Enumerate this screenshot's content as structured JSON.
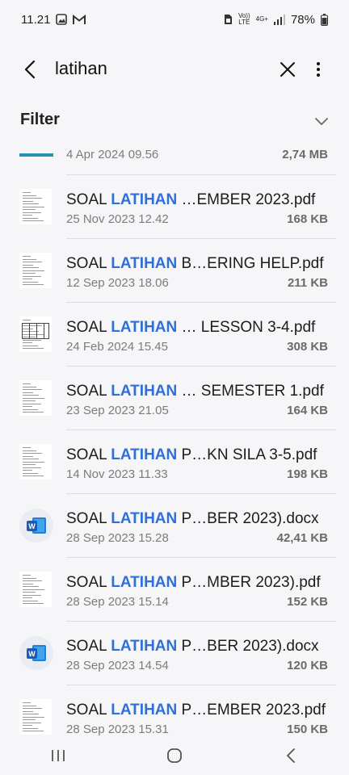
{
  "status": {
    "time": "11.21",
    "volte": "Vo))",
    "lte": "LTE",
    "net": "4G+",
    "battery": "78%"
  },
  "search": {
    "query": "latihan"
  },
  "filter": {
    "label": "Filter"
  },
  "highlight_color": "#2f6fd8",
  "partial_item": {
    "date": "4 Apr 2024 09.56",
    "size": "2,74 MB"
  },
  "files": [
    {
      "prefix": "SOAL ",
      "hl": "LATIHAN",
      "suffix": " …EMBER 2023.pdf",
      "date": "25 Nov 2023 12.42",
      "size": "168 KB",
      "icon": "pdf-thumbnail"
    },
    {
      "prefix": "SOAL ",
      "hl": "LATIHAN",
      "suffix": " B…ERING HELP.pdf",
      "date": "12 Sep 2023 18.06",
      "size": "211 KB",
      "icon": "pdf-thumbnail"
    },
    {
      "prefix": "SOAL ",
      "hl": "LATIHAN",
      "suffix": " … LESSON 3-4.pdf",
      "date": "24 Feb 2024 15.45",
      "size": "308 KB",
      "icon": "pdf-thumbnail-table"
    },
    {
      "prefix": "SOAL ",
      "hl": "LATIHAN",
      "suffix": " … SEMESTER 1.pdf",
      "date": "23 Sep 2023 21.05",
      "size": "164 KB",
      "icon": "pdf-thumbnail"
    },
    {
      "prefix": "SOAL ",
      "hl": "LATIHAN",
      "suffix": " P…KN SILA 3-5.pdf",
      "date": "14 Nov 2023 11.33",
      "size": "198 KB",
      "icon": "pdf-thumbnail"
    },
    {
      "prefix": "SOAL ",
      "hl": "LATIHAN",
      "suffix": " P…BER 2023).docx",
      "date": "28 Sep 2023 15.28",
      "size": "42,41 KB",
      "icon": "word-icon"
    },
    {
      "prefix": "SOAL ",
      "hl": "LATIHAN",
      "suffix": " P…MBER 2023).pdf",
      "date": "28 Sep 2023 15.14",
      "size": "152 KB",
      "icon": "pdf-thumbnail"
    },
    {
      "prefix": "SOAL ",
      "hl": "LATIHAN",
      "suffix": " P…BER 2023).docx",
      "date": "28 Sep 2023 14.54",
      "size": "120 KB",
      "icon": "word-icon"
    },
    {
      "prefix": "SOAL ",
      "hl": "LATIHAN",
      "suffix": " P…EMBER 2023.pdf",
      "date": "28 Sep 2023 15.31",
      "size": "150 KB",
      "icon": "pdf-thumbnail"
    }
  ]
}
